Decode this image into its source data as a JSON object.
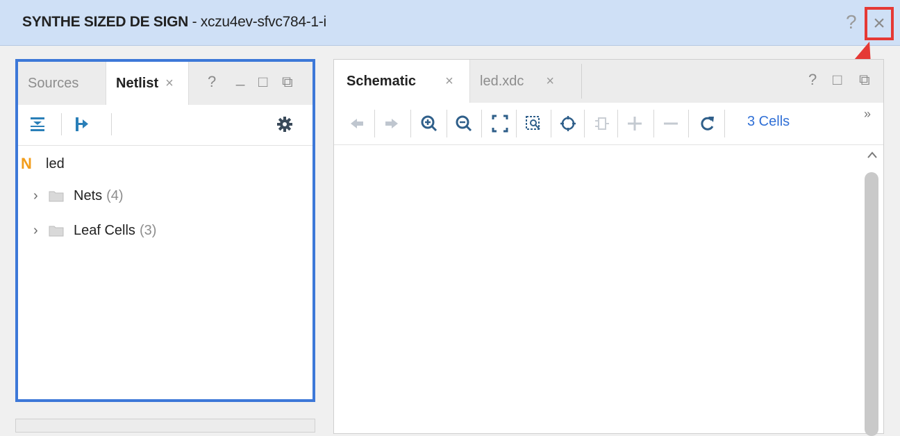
{
  "titlebar": {
    "title_bold": "SYNTHE SIZED DE SIGN",
    "title_rest": " - xczu4ev-sfvc784-1-i",
    "help_glyph": "?",
    "close_glyph": "×"
  },
  "left_panel": {
    "tabs": [
      {
        "label": "Sources",
        "active": false
      },
      {
        "label": "Netlist",
        "active": true,
        "close": "×"
      }
    ],
    "window_controls": {
      "help": "?",
      "minimize": "_",
      "maximize": "□",
      "float": "⧉"
    },
    "tree": {
      "root": {
        "icon_letter": "N",
        "label": "led"
      },
      "children": [
        {
          "label": "Nets",
          "count": "(4)"
        },
        {
          "label": "Leaf Cells",
          "count": "(3)"
        }
      ]
    },
    "colors": {
      "accent_border": "#3d78d8",
      "netlist_N": "#f29d1b"
    }
  },
  "right_panel": {
    "tabs": [
      {
        "label": "Schematic",
        "active": true,
        "close": "×"
      },
      {
        "label": "led.xdc",
        "active": false,
        "close": "×"
      }
    ],
    "window_controls": {
      "help": "?",
      "maximize": "□",
      "float": "⧉"
    },
    "toolbar": {
      "cells_link": "3 Cells",
      "more": "»"
    }
  },
  "annotation": {
    "highlight_color": "#e53935"
  }
}
